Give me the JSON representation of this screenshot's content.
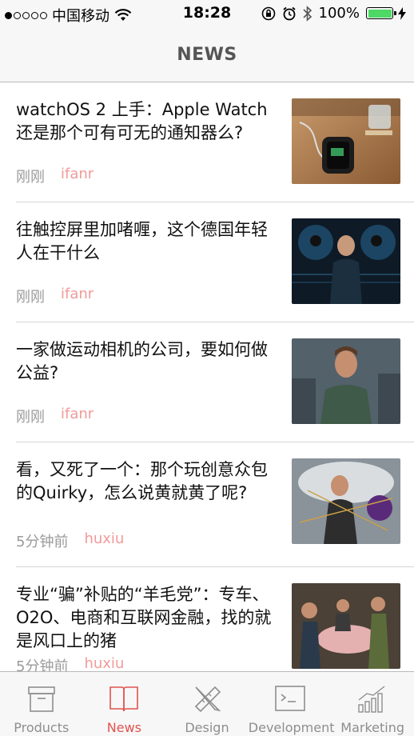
{
  "status_bar": {
    "carrier": "中国移动",
    "time": "18:28",
    "battery": "100%",
    "signal_bars_filled": 1,
    "signal_bars_total": 5
  },
  "nav": {
    "title": "NEWS"
  },
  "articles": [
    {
      "title": "watchOS 2 上手：Apple Watch 还是那个可有可无的通知器么?",
      "time": "刚刚",
      "source": "ifanr"
    },
    {
      "title": "往触控屏里加啫喱，这个德国年轻人在干什么",
      "time": "刚刚",
      "source": "ifanr"
    },
    {
      "title": "一家做运动相机的公司，要如何做公益?",
      "time": "刚刚",
      "source": "ifanr"
    },
    {
      "title": "看，又死了一个：那个玩创意众包的Quirky，怎么说黄就黄了呢?",
      "time": "5分钟前",
      "source": "huxiu"
    },
    {
      "title": "专业“骗”补贴的“羊毛党”：专车、O2O、电商和互联网金融，找的就是风口上的猪",
      "time": "5分钟前",
      "source": "huxiu"
    }
  ],
  "tabs": [
    {
      "label": "Products",
      "icon": "box-icon"
    },
    {
      "label": "News",
      "icon": "book-icon"
    },
    {
      "label": "Design",
      "icon": "ruler-pencil-icon"
    },
    {
      "label": "Development",
      "icon": "terminal-icon"
    },
    {
      "label": "Marketing",
      "icon": "bar-chart-icon"
    }
  ],
  "active_tab": "News",
  "colors": {
    "accent": "#e0534f",
    "source_text": "#f29a9a",
    "meta_text": "#9a9a9a",
    "battery_fill": "#4cd964"
  }
}
